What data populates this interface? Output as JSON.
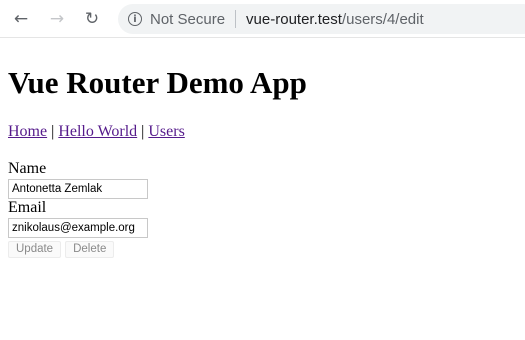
{
  "browser": {
    "back_icon": "←",
    "forward_icon": "→",
    "reload_icon": "↻",
    "info_icon": "i",
    "security_label": "Not Secure",
    "url_host": "vue-router.test",
    "url_path": "/users/4/edit"
  },
  "page": {
    "title": "Vue Router Demo App",
    "nav": {
      "home": "Home",
      "hello": "Hello World",
      "users": "Users",
      "separator": "|"
    },
    "form": {
      "name_label": "Name",
      "name_value": "Antonetta Zemlak",
      "email_label": "Email",
      "email_value": "znikolaus@example.org",
      "update_label": "Update",
      "delete_label": "Delete"
    }
  },
  "colors": {
    "link": "#551a8b",
    "button_text": "#8a8a8a"
  }
}
